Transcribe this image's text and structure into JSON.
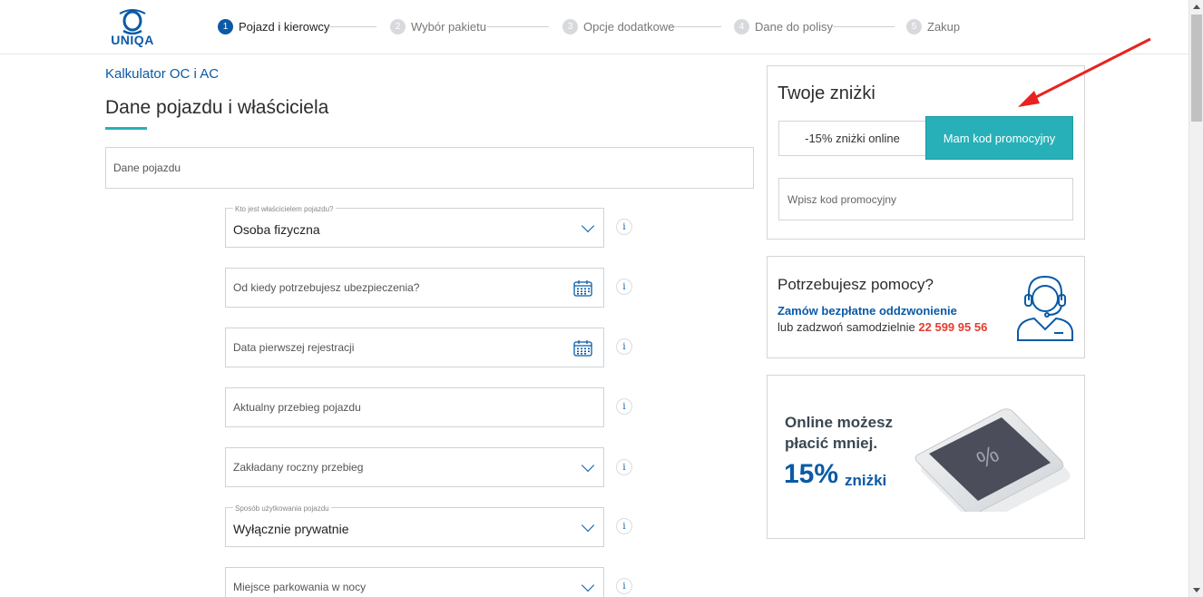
{
  "header": {
    "logo_text": "UNIQA",
    "steps": [
      {
        "num": "1",
        "label": "Pojazd i kierowcy",
        "active": true
      },
      {
        "num": "2",
        "label": "Wybór pakietu",
        "active": false
      },
      {
        "num": "3",
        "label": "Opcje dodatkowe",
        "active": false
      },
      {
        "num": "4",
        "label": "Dane do polisy",
        "active": false
      },
      {
        "num": "5",
        "label": "Zakup",
        "active": false
      }
    ]
  },
  "main": {
    "breadcrumb": "Kalkulator OC i AC",
    "title": "Dane pojazdu i właściciela",
    "section_label": "Dane pojazdu",
    "fields": [
      {
        "label": "Kto jest właścicielem pojazdu?",
        "value": "Osoba fizyczna",
        "type": "select"
      },
      {
        "label": "",
        "placeholder": "Od kiedy potrzebujesz ubezpieczenia?",
        "type": "date"
      },
      {
        "label": "",
        "placeholder": "Data pierwszej rejestracji",
        "type": "date"
      },
      {
        "label": "",
        "placeholder": "Aktualny przebieg pojazdu",
        "type": "text"
      },
      {
        "label": "",
        "placeholder": "Zakładany roczny przebieg",
        "type": "select"
      },
      {
        "label": "Sposób użytkowania pojazdu",
        "value": "Wyłącznie prywatnie",
        "type": "select"
      },
      {
        "label": "",
        "placeholder": "Miejsce parkowania w nocy",
        "type": "select"
      }
    ],
    "info_glyph": "i"
  },
  "discounts": {
    "title": "Twoje zniżki",
    "online_button": "-15% zniżki online",
    "promo_button": "Mam kod promocyjny",
    "promo_placeholder": "Wpisz kod promocyjny"
  },
  "help": {
    "title": "Potrzebujesz pomocy?",
    "callback_link": "Zamów bezpłatne oddzwonienie",
    "call_text": "lub zadzwoń samodzielnie",
    "phone": "22 599 95 56",
    "icon": "call-center-agent-icon"
  },
  "banner": {
    "line1": "Online możesz",
    "line2": "płacić mniej.",
    "percent": "15%",
    "percent_word": "zniżki",
    "phone_symbol": "%"
  },
  "colors": {
    "brand_blue": "#0a5aa6",
    "teal": "#27b0b8",
    "phone_red": "#e53b2f",
    "annotation_arrow": "#e8231f"
  }
}
